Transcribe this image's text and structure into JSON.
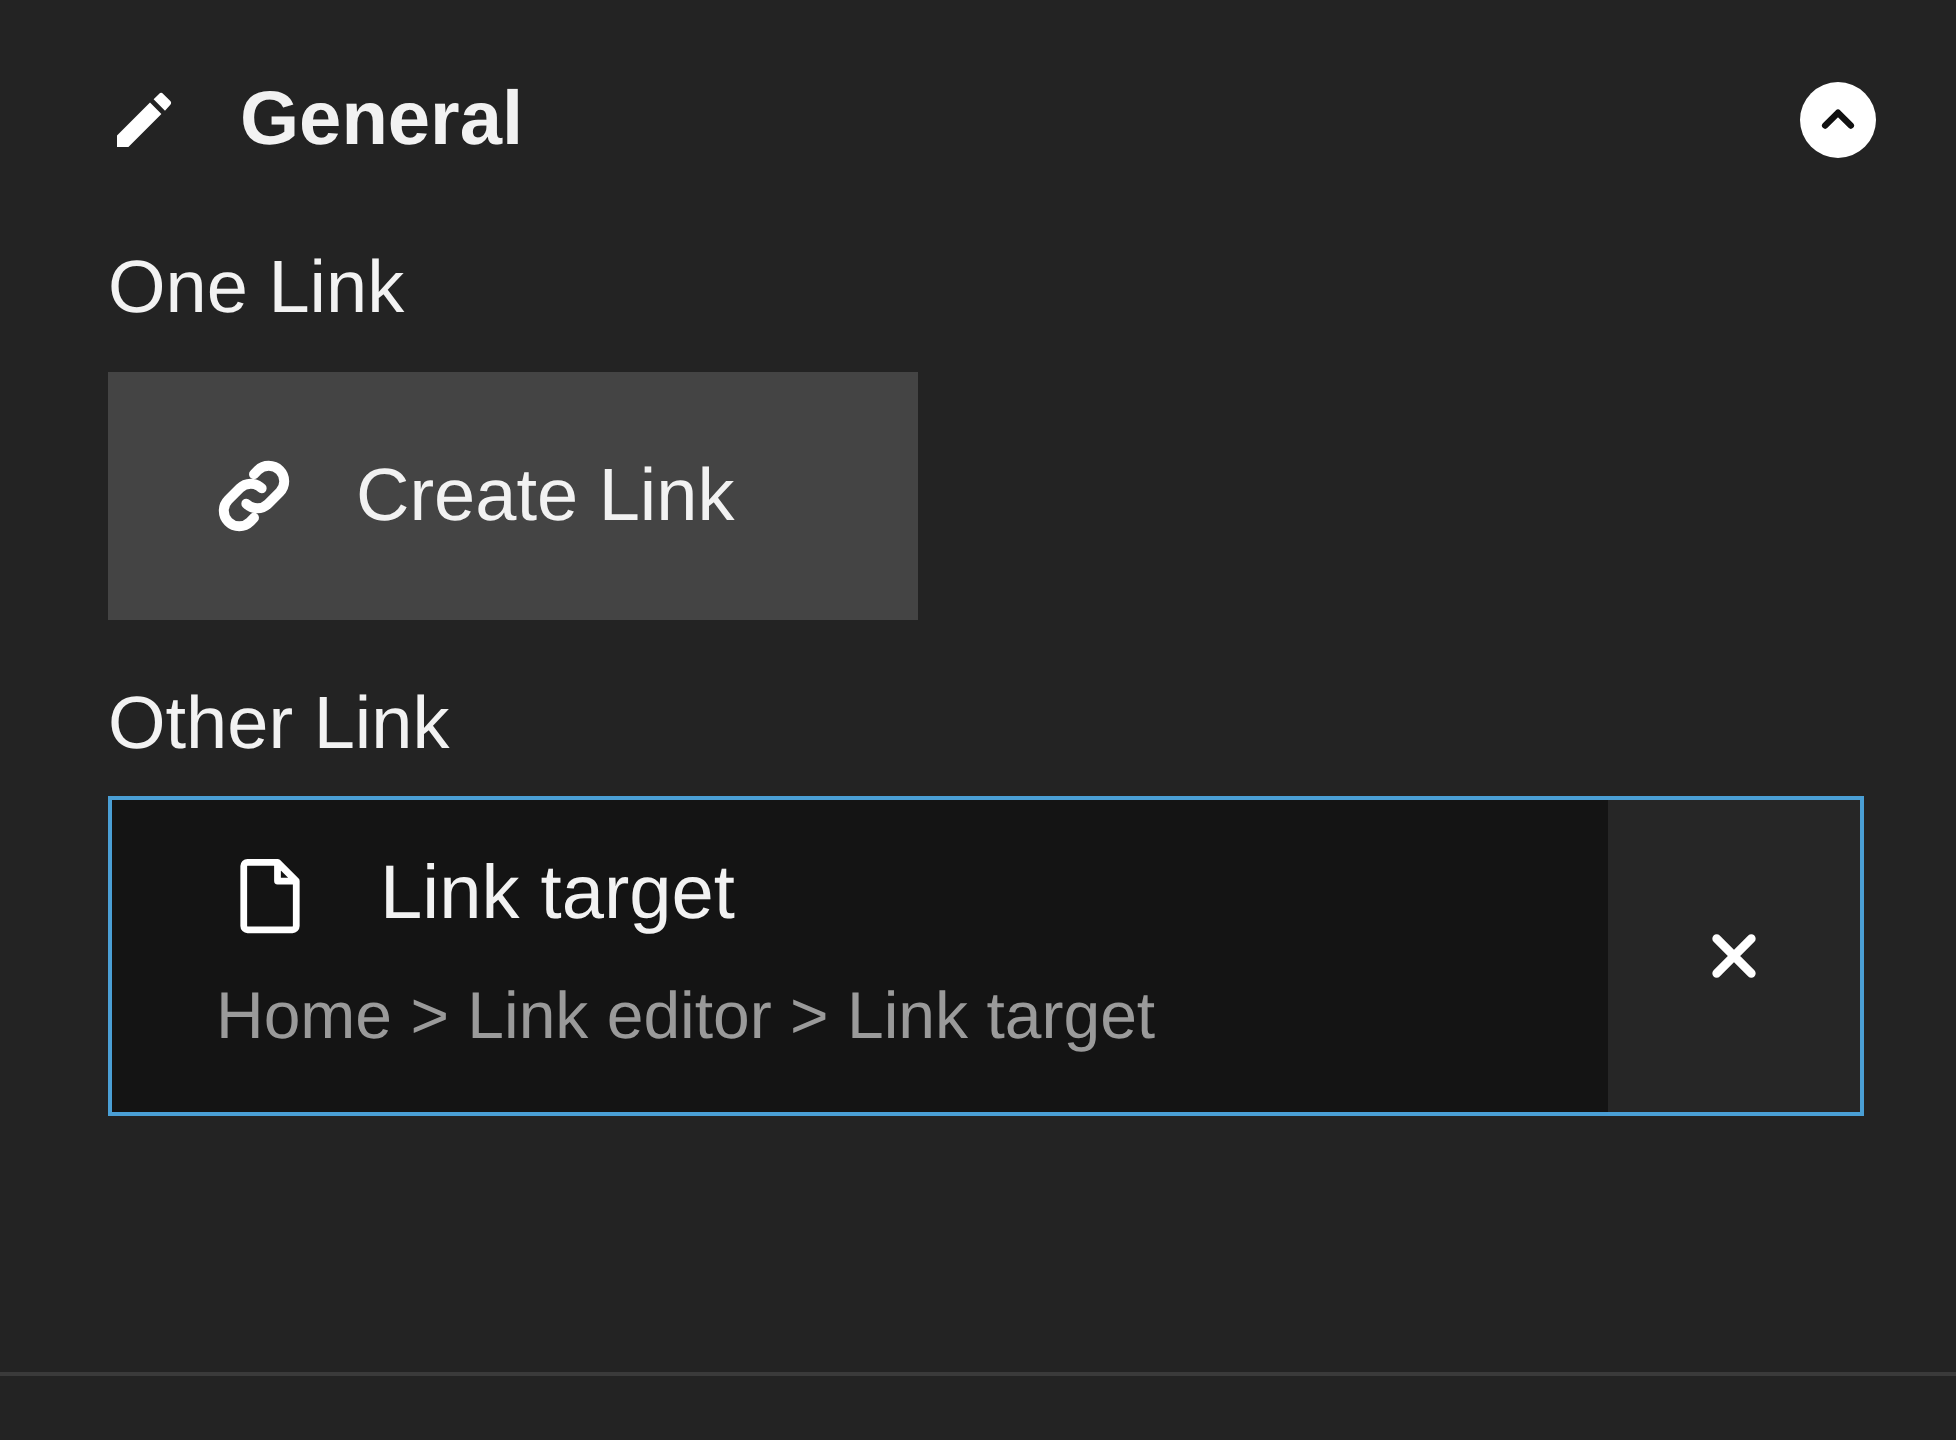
{
  "section": {
    "title": "General",
    "expanded": true,
    "fields": [
      {
        "kind": "button",
        "label": "One Link",
        "button": "Create Link"
      },
      {
        "kind": "link",
        "label": "Other Link",
        "focused": true,
        "link": {
          "title": "Link target",
          "path": "Home > Link editor > Link target"
        }
      }
    ]
  }
}
